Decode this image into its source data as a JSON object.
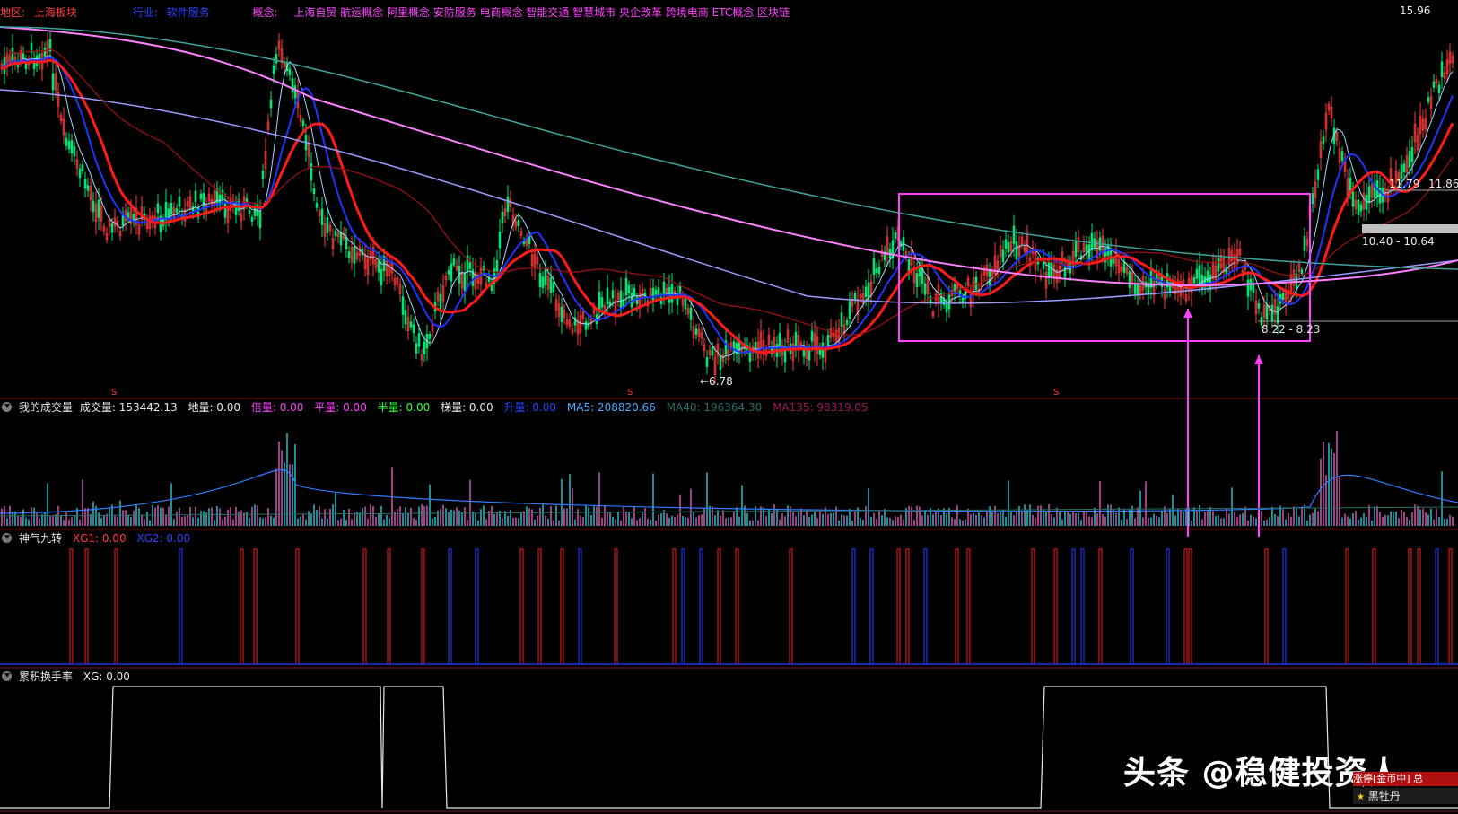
{
  "top_bar": {
    "region_label": "地区:",
    "region_value": "上海板块",
    "industry_label": "行业:",
    "industry_value": "软件服务",
    "concept_label": "概念:",
    "concepts": "上海自贸 航运概念 阿里概念 安防服务 电商概念 智能交通 智慧城市 央企改革 跨境电商 ETC概念 区块链"
  },
  "price_pane": {
    "max_label": "15.96",
    "min_label": "←6.78",
    "range_label_1": "8.22 - 8.23",
    "range_label_2": "10.40 - 10.64",
    "level_label_a": "11.79",
    "level_label_b": "11.86",
    "signal_marker": "S",
    "colors": {
      "ma_red": "#ff1a1a",
      "ma_blue": "#2233ff",
      "ma_pink": "#ff80ff",
      "ma_teal": "#3ea39a",
      "ma_lavender": "#9b9bff",
      "ma_darkred": "#a01010",
      "box": "#ff40ff",
      "up": "#ff3b3b",
      "down": "#00e676"
    }
  },
  "volume_pane": {
    "title": "我的成交量",
    "vol": "成交量: 153442.13",
    "ground": "地量: 0.00",
    "bei": "倍量: 0.00",
    "ping": "平量: 0.00",
    "ban": "半量: 0.00",
    "ti": "梯量: 0.00",
    "sheng": "升量: 0.00",
    "ma5": "MA5: 208820.66",
    "ma40": "MA40: 196364.30",
    "ma135": "MA135: 98319.05"
  },
  "nine_turn_pane": {
    "title": "神气九转",
    "xg1": "XG1: 0.00",
    "xg2": "XG2: 0.00"
  },
  "turnover_pane": {
    "title": "累积换手率",
    "xg": "XG: 0.00"
  },
  "watermark": "头条 @稳健投资人",
  "stock_tag": {
    "line1": "涨停[金币中] 总",
    "line2": "黑牡丹"
  }
}
